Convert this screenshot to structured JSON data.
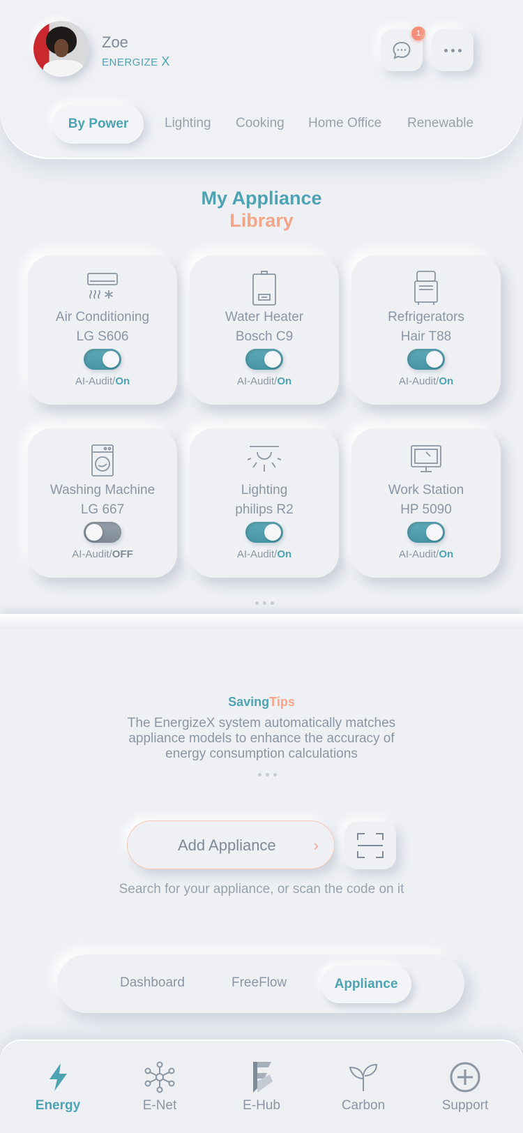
{
  "user": {
    "name": "Zoe",
    "brand": "ENERGIZE",
    "brand_suffix": "X",
    "notifications": "1"
  },
  "category_tabs": [
    "By Power",
    "Lighting",
    "Cooking",
    "Home Office",
    "Renewable"
  ],
  "library": {
    "title_line1": "My Appliance",
    "title_line2": "Library"
  },
  "appliances": [
    {
      "name": "Air Conditioning",
      "model": "LG S606",
      "audit_label": "AI-Audit/",
      "audit_state": "On",
      "icon": "air-conditioner-icon",
      "enabled": true
    },
    {
      "name": "Water Heater",
      "model": "Bosch C9",
      "audit_label": "AI-Audit/",
      "audit_state": "On",
      "icon": "water-heater-icon",
      "enabled": true
    },
    {
      "name": "Refrigerators",
      "model": "Hair T88",
      "audit_label": "AI-Audit/",
      "audit_state": "On",
      "icon": "refrigerator-icon",
      "enabled": true
    },
    {
      "name": "Washing Machine",
      "model": "LG 667",
      "audit_label": "AI-Audit/",
      "audit_state": "OFF",
      "icon": "washing-machine-icon",
      "enabled": false
    },
    {
      "name": "Lighting",
      "model": "philips R2",
      "audit_label": "AI-Audit/",
      "audit_state": "On",
      "icon": "ceiling-light-icon",
      "enabled": true
    },
    {
      "name": "Work Station",
      "model": "HP 5090",
      "audit_label": "AI-Audit/",
      "audit_state": "On",
      "icon": "monitor-icon",
      "enabled": true
    }
  ],
  "tips": {
    "title_a": "Saving",
    "title_b": "Tips",
    "text": "The EnergizeX system automatically matches appliance models to enhance the accuracy of energy consumption calculations"
  },
  "add": {
    "label": "Add Appliance",
    "chevron": "›",
    "hint": "Search for your appliance, or scan the code on it"
  },
  "segment": [
    "Dashboard",
    "FreeFlow",
    "Appliance"
  ],
  "bottom_nav": [
    {
      "label": "Energy",
      "icon": "lightning-icon"
    },
    {
      "label": "E-Net",
      "icon": "network-icon"
    },
    {
      "label": "E-Hub",
      "icon": "hub-logo-icon"
    },
    {
      "label": "Carbon",
      "icon": "sprout-icon"
    },
    {
      "label": "Support",
      "icon": "plus-circle-icon"
    }
  ],
  "colors": {
    "accent": "#4ea3b3",
    "secondary": "#f4a58a",
    "background": "#eef0f4"
  }
}
